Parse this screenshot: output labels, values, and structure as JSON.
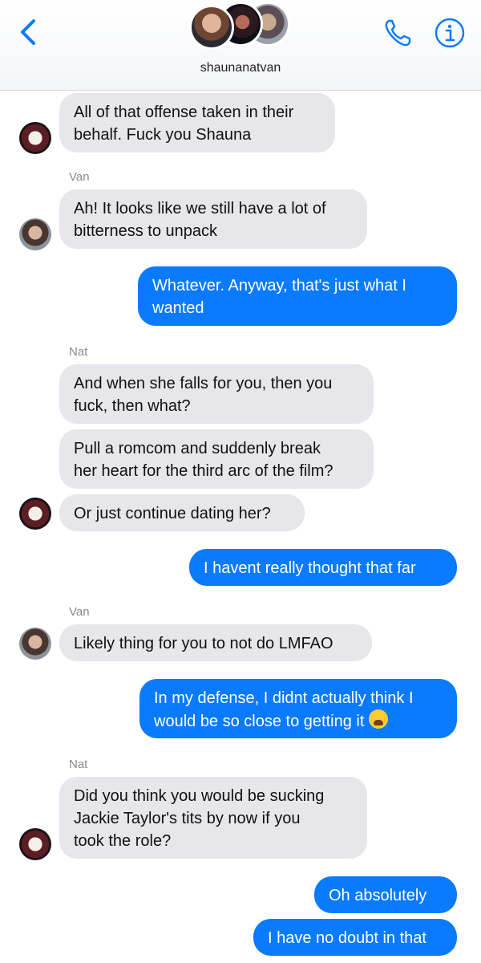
{
  "header": {
    "conversation_name": "shaunanatvan",
    "back_icon": "chevron-left-icon",
    "call_icon": "phone-icon",
    "info_icon": "info-icon",
    "accent_color": "#0a7aff"
  },
  "messages": [
    {
      "text": "All of that offense taken in their\nbehalf. Fuck you Shauna"
    },
    {
      "sender": "Van",
      "text": "Ah! It looks like we still have a lot of\nbitterness to unpack"
    },
    {
      "text": "Whatever. Anyway, that's just what I\nwanted"
    },
    {
      "sender": "Nat",
      "text": "And when she falls for you, then you\nfuck, then what?"
    },
    {
      "text": "Pull a romcom and suddenly break\nher heart for the third arc of the film?"
    },
    {
      "text": "Or just continue dating her?"
    },
    {
      "text": "I havent really thought that far"
    },
    {
      "sender": "Van",
      "text": "Likely thing for you to not do LMFAO"
    },
    {
      "text": "In my defense, I didnt actually think I\nwould be so close to getting it",
      "emoji": "loudly-crying-face"
    },
    {
      "sender": "Nat",
      "text": "Did you think you would be sucking\nJackie Taylor's tits by now if you\ntook the role?"
    },
    {
      "text": "Oh absolutely"
    },
    {
      "text": "I have no doubt in that"
    }
  ],
  "colors": {
    "incoming_bubble": "#e6e6eb",
    "outgoing_bubble": "#0a7aff"
  }
}
